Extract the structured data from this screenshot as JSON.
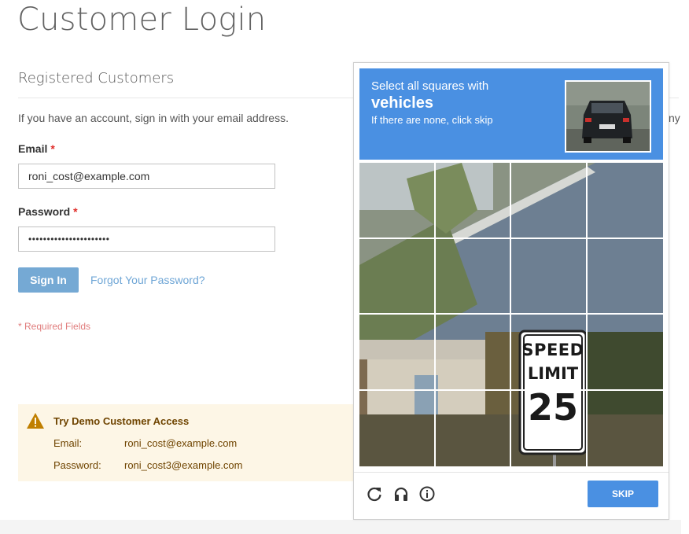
{
  "page": {
    "title": "Customer Login"
  },
  "login": {
    "block_title": "Registered Customers",
    "intro": "If you have an account, sign in with your email address.",
    "cutoff_text": "ny",
    "email_label": "Email",
    "email_value": "roni_cost@example.com",
    "password_label": "Password",
    "password_value": "••••••••••••••••••••••",
    "required_mark": "*",
    "signin_label": "Sign In",
    "forgot_label": "Forgot Your Password?",
    "required_note": "* Required Fields"
  },
  "demo": {
    "title": "Try Demo Customer Access",
    "email_key": "Email:",
    "email_value": "roni_cost@example.com",
    "password_key": "Password:",
    "password_value": "roni_cost3@example.com",
    "icon": "warning-icon"
  },
  "captcha": {
    "prompt_line1": "Select all squares with",
    "prompt_target": "vehicles",
    "prompt_line3": "If there are none, click skip",
    "skip_label": "SKIP",
    "sign_line1": "SPEED",
    "sign_line2": "LIMIT",
    "sign_line3": "25",
    "icons": [
      "reload-icon",
      "audio-icon",
      "info-icon"
    ],
    "accent_color": "#4a90e2"
  }
}
